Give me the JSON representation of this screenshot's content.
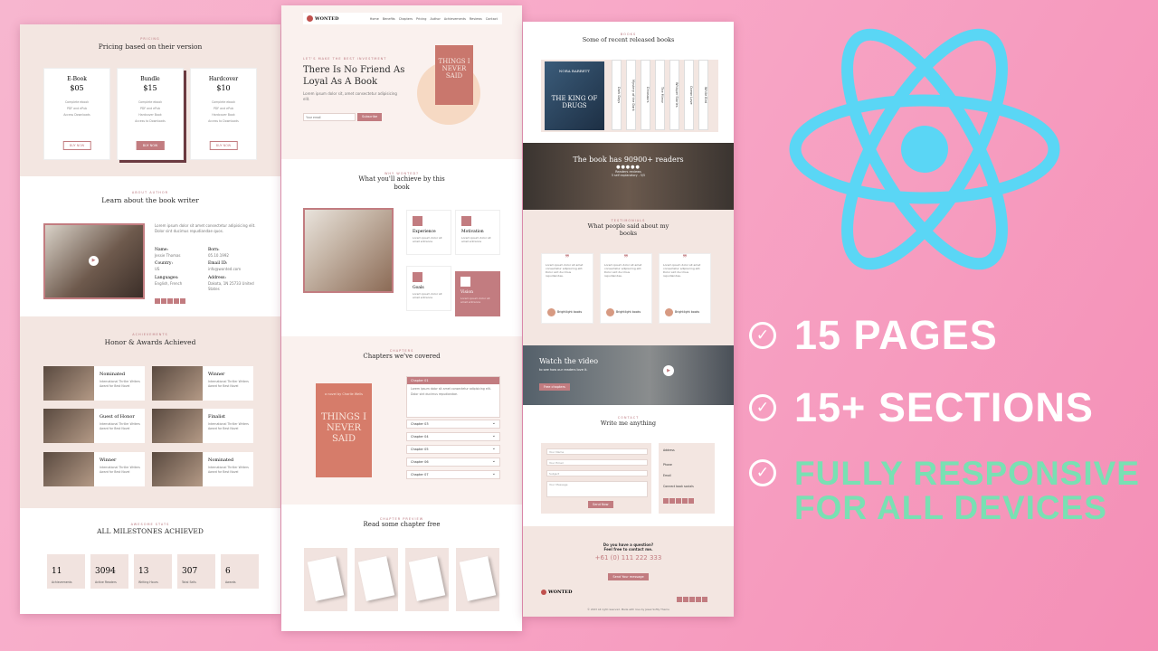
{
  "colors": {
    "accent": "#c27c80",
    "react": "#5ad6f5",
    "green": "#79e0b3"
  },
  "features": [
    {
      "label": "15 PAGES"
    },
    {
      "label": "15+ SECTIONS"
    },
    {
      "label": "FULLY RESPONSIVE",
      "label2": "FOR ALL DEVICES"
    }
  ],
  "left": {
    "pricing": {
      "kicker": "PRICING",
      "title": "Pricing based on their version",
      "plans": [
        {
          "name": "E-Book",
          "price": "$05",
          "feat": "Complete ebook\nPDF and ePub\nAccess Downloads",
          "btn": "BUY NOW"
        },
        {
          "name": "Bundle",
          "price": "$15",
          "feat": "Complete ebook\nPDF and ePub\nHardcover Book\nAccess to Downloads",
          "btn": "BUY NOW"
        },
        {
          "name": "Hardcover",
          "price": "$10",
          "feat": "Complete ebook\nPDF and ePub\nHardcover Book\nAccess to Downloads",
          "btn": "BUY NOW"
        }
      ]
    },
    "author": {
      "kicker": "ABOUT AUTHOR",
      "title": "Learn about the book writer",
      "name_l": "Name:",
      "name_v": "Jessie Thomas",
      "born_l": "Born:",
      "born_v": "05.10.1992",
      "country_l": "Country:",
      "country_v": "US",
      "email_l": "Email ID:",
      "email_v": "info@wonted.com",
      "lang_l": "Languages:",
      "lang_v": "English, French",
      "addr_l": "Address:",
      "addr_v": "Dakota, 1N 25733 United States"
    },
    "awards": {
      "kicker": "ACHIEVEMENTS",
      "title": "Honor & Awards Achieved",
      "items": [
        {
          "name": "Nominated",
          "desc": "International Thriller Writers Award for Best Novel"
        },
        {
          "name": "Winner",
          "desc": "International Thriller Writers Award for Best Novel"
        },
        {
          "name": "Guest of Honor",
          "desc": "International Thriller Writers Award for Best Novel"
        },
        {
          "name": "Finalist",
          "desc": "International Thriller Writers Award for Best Novel"
        },
        {
          "name": "Winner",
          "desc": "International Thriller Writers Award for Best Novel"
        },
        {
          "name": "Nominated",
          "desc": "International Thriller Writers Award for Best Novel"
        }
      ]
    },
    "stats": {
      "kicker": "AWESOME STATS",
      "title": "ALL MILESTONES ACHIEVED",
      "items": [
        {
          "n": "11",
          "l": "Achievements"
        },
        {
          "n": "3094",
          "l": "Active Readers"
        },
        {
          "n": "13",
          "l": "Writing Hours"
        },
        {
          "n": "307",
          "l": "Total Sells"
        },
        {
          "n": "6",
          "l": "Awards"
        }
      ]
    }
  },
  "middle": {
    "nav": {
      "logo": "WONTED",
      "links": [
        "Home",
        "Benefits",
        "Chapters",
        "Pricing",
        "Author",
        "Achievements",
        "Reviews",
        "Contact"
      ]
    },
    "hero": {
      "kicker": "LET'S MAKE THE BEST INVESTMENT",
      "title1": "There Is No Friend As",
      "title2": "Loyal As A Book",
      "desc": "Lorem ipsum dolor sit, amet consectetur adipisicing elit.",
      "placeholder": "Your email",
      "btn": "Subscribe",
      "book": "THINGS I NEVER SAID"
    },
    "achieve": {
      "kicker": "WHY WONTED?",
      "title1": "What you'll achieve by this",
      "title2": "book",
      "items": [
        {
          "t": "Experience",
          "d": "Lorem ipsum dolor sit amet entrance"
        },
        {
          "t": "Motivation",
          "d": "Lorem ipsum dolor sit amet entrance"
        },
        {
          "t": "Goals",
          "d": "Lorem ipsum dolor sit amet entrance"
        },
        {
          "t": "Vision",
          "d": "Lorem ipsum dolor sit amet entrance"
        }
      ]
    },
    "chapters": {
      "kicker": "CHAPTERS",
      "title": "Chapters we've covered",
      "open": "Chapter 01",
      "open_desc": "Lorem ipsum dolor sit amet consectetur adipisicing elit. Dolor sint ducimus repudiandae.",
      "list": [
        "Chapter 03",
        "Chapter 04",
        "Chapter 05",
        "Chapter 06",
        "Chapter 07"
      ],
      "book_author": "a novel by Charlie Wells",
      "book": "THINGS I NEVER SAID"
    },
    "free": {
      "kicker": "CHAPTER PREVIEW",
      "title": "Read some chapter free"
    }
  },
  "right": {
    "released": {
      "kicker": "BOOKS",
      "title": "Some of recent released books",
      "featured": "THE KING OF DRUGS",
      "author": "NORA BARRETT",
      "spines": [
        "Dark Days",
        "Mystery of the Dark",
        "Dinosaurs",
        "The Mirror",
        "Whisper Stories",
        "Ocean Love",
        "White Bird"
      ]
    },
    "readers": {
      "title": "The book has 90900+ readers",
      "sub": "Readers reviews",
      "rating": "5 self explanatory - 5/5"
    },
    "testimonials": {
      "kicker": "TESTIMONIALS",
      "title1": "What people said about my",
      "title2": "books",
      "text": "Lorem ipsum dolor sit amet consectetur adipisicing elit. Dolor sint ducimus repudiandae.",
      "name": "Brightlight books",
      "role": "Happy Customer"
    },
    "video": {
      "title": "Watch the video",
      "sub": "to see how our readers love it.",
      "btn": "Free chapters"
    },
    "contact": {
      "kicker": "CONTACT",
      "title": "Write me anything",
      "fields": [
        "Your Name",
        "Your Email",
        "Subject",
        "Your Message"
      ],
      "btn": "Send Now",
      "addr_l": "Address",
      "phone_l": "Phone",
      "email_l": "Email",
      "social_l": "Connect book socials"
    },
    "cta": {
      "q1": "Do you have a question?",
      "q2": "Feel free to contact me.",
      "phone": "+61 (0) 111 222 333",
      "btn": "Send Your message"
    },
    "footer": {
      "logo": "WONTED",
      "copy": "© 2023 All right reserved. Made with love by Jewel Softly Theme"
    }
  }
}
